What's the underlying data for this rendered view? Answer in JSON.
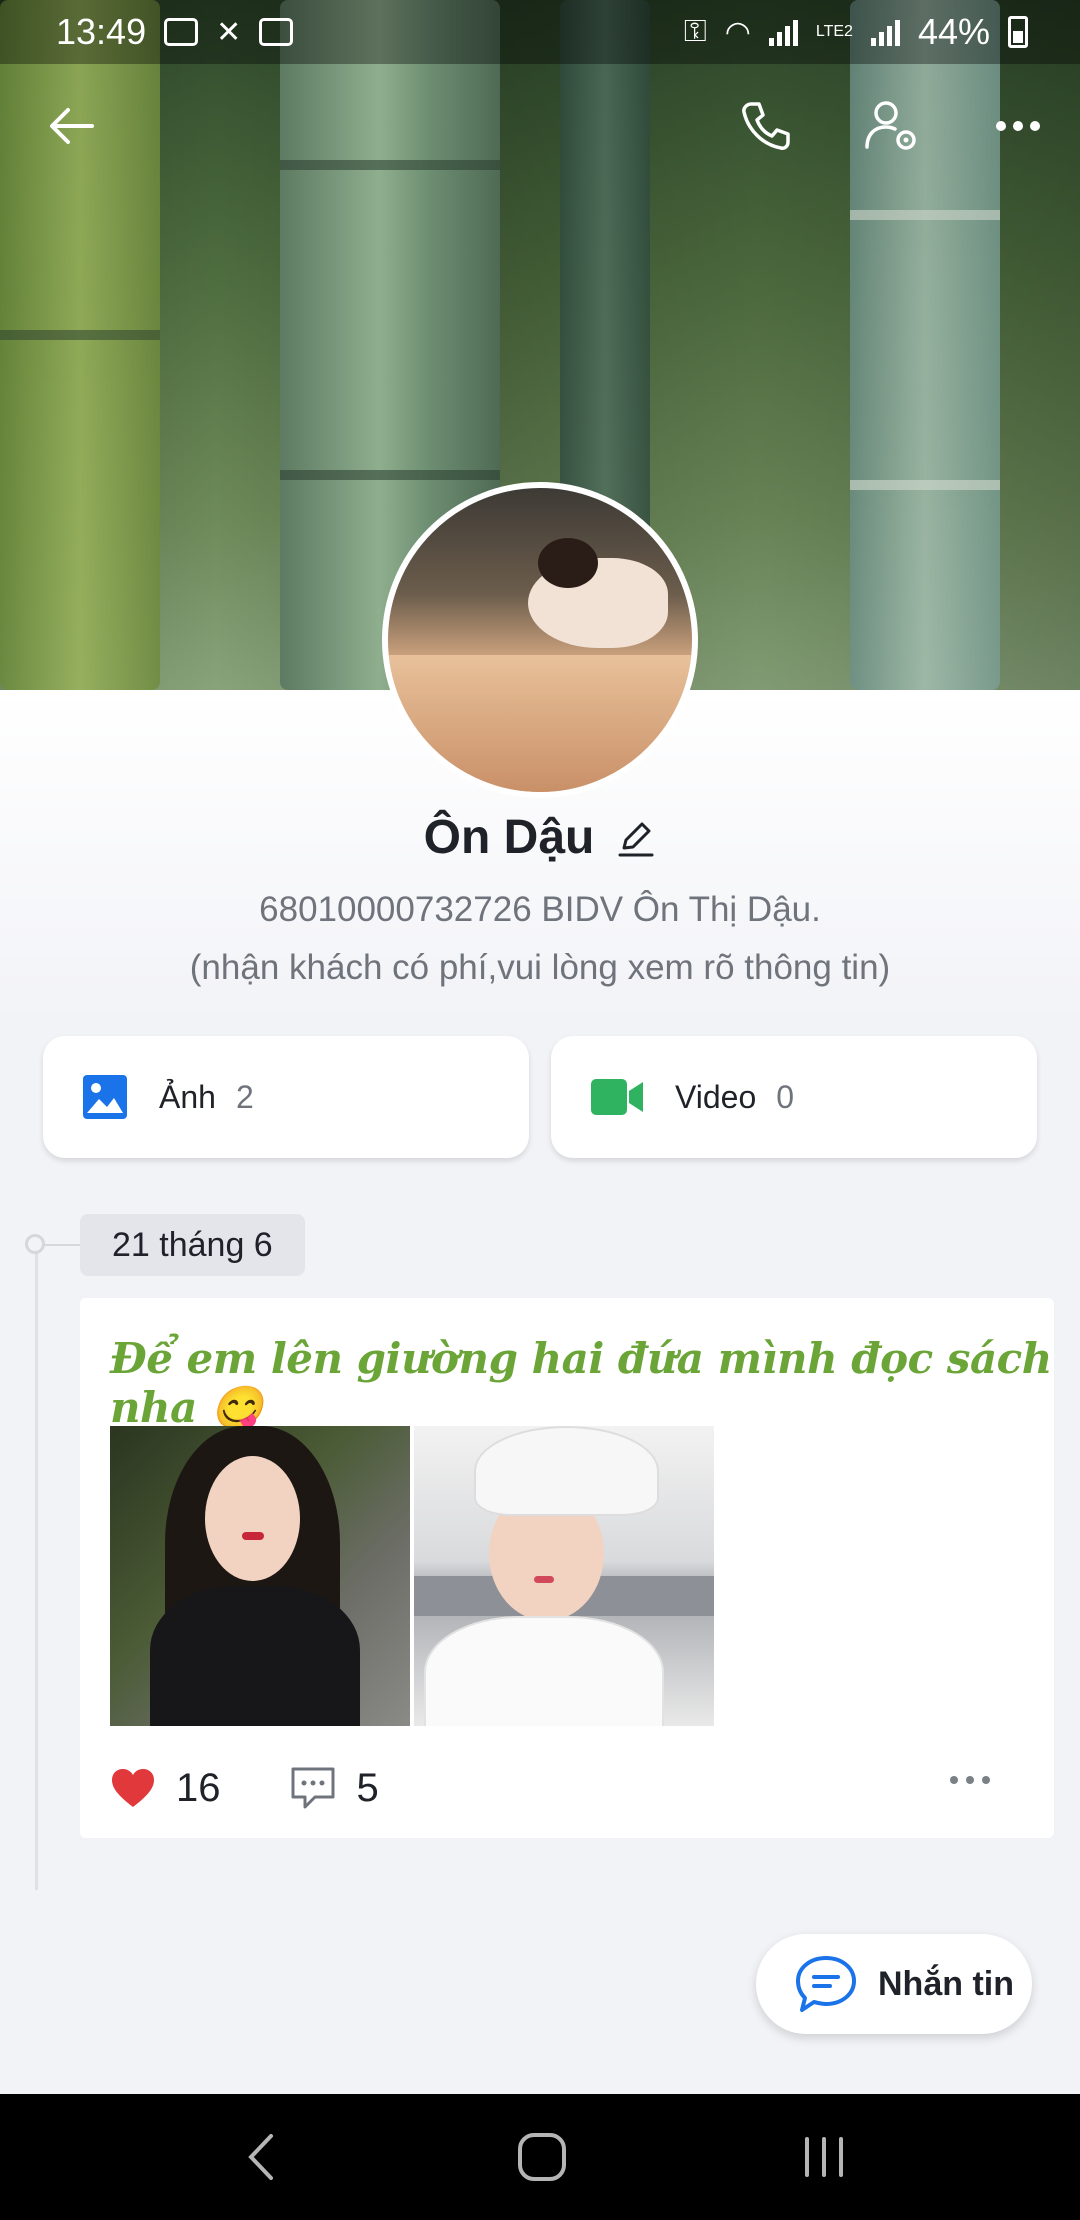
{
  "status_bar": {
    "time": "13:49",
    "network_label": "LTE2",
    "battery": "44%"
  },
  "top_bar": {
    "back_icon": "arrow-left-icon",
    "call_icon": "phone-icon",
    "settings_icon": "user-settings-icon",
    "more_icon": "more-horizontal-icon"
  },
  "profile": {
    "name": "Ôn Dậu",
    "bio_line1": "68010000732726  BIDV  Ôn Thị Dậu.",
    "bio_line2": "(nhận khách có phí,vui lòng xem rõ thông tin)"
  },
  "media": {
    "photos_label": "Ảnh",
    "photos_count": "2",
    "videos_label": "Video",
    "videos_count": "0"
  },
  "timeline": {
    "date": "21 tháng 6",
    "post": {
      "text": "Để em lên giường hai đứa mình đọc sách nha 😋",
      "likes": "16",
      "comments": "5"
    }
  },
  "chat_button": {
    "label": "Nhắn tin"
  },
  "colors": {
    "accent_blue": "#1a73e8",
    "video_green": "#2fb360",
    "post_text_green": "#6ba538",
    "like_red": "#e0383b"
  }
}
